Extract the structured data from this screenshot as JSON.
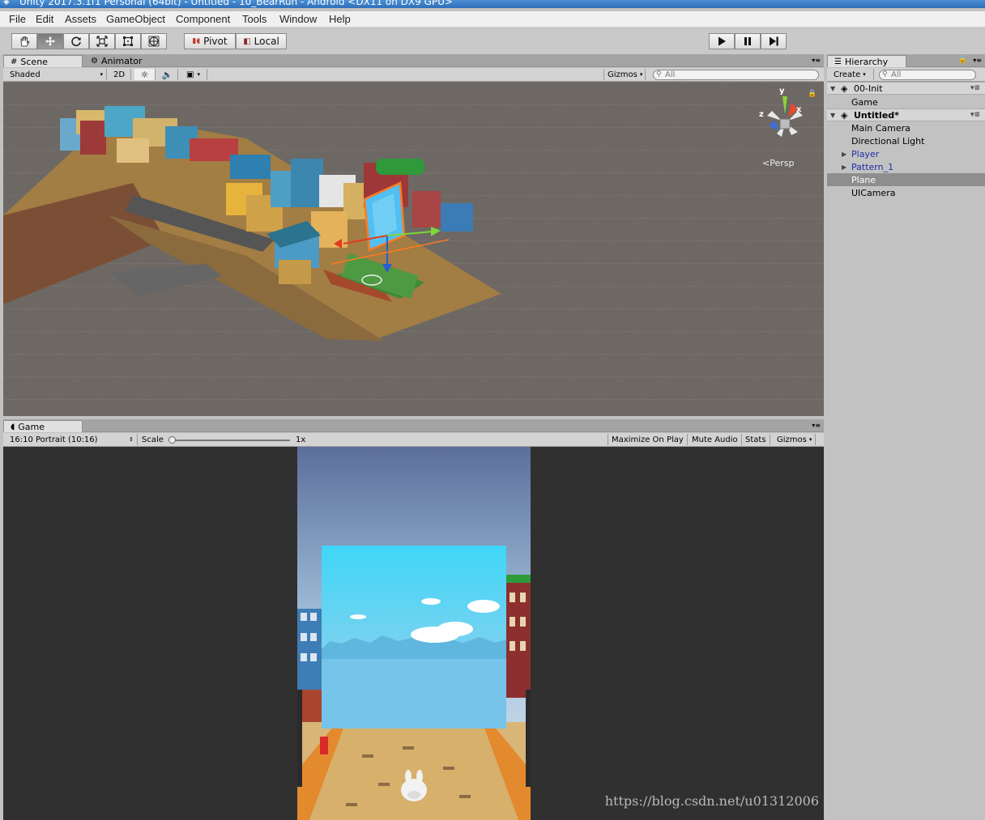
{
  "window": {
    "title": "Unity 2017.3.1f1 Personal (64bit) - Untitled - 10_BearRun - Android <DX11 on DX9 GPU>"
  },
  "menu": [
    "File",
    "Edit",
    "Assets",
    "GameObject",
    "Component",
    "Tools",
    "Window",
    "Help"
  ],
  "toolbar": {
    "tools": [
      "hand-icon",
      "move-icon",
      "rotate-icon",
      "scale-icon",
      "rect-icon",
      "transform-icon"
    ],
    "active_tool": "move-icon",
    "pivot_label": "Pivot",
    "local_label": "Local",
    "play": [
      "play-icon",
      "pause-icon",
      "step-icon"
    ]
  },
  "scene_panel": {
    "tabs": [
      {
        "label": "Scene"
      },
      {
        "label": "Animator"
      }
    ],
    "shading": "Shaded",
    "mode_2d": "2D",
    "gizmos": "Gizmos",
    "search_placeholder": "All",
    "persp": "Persp",
    "axis": {
      "y": "y",
      "x": "x",
      "z": "z"
    }
  },
  "game_panel": {
    "tab": "Game",
    "aspect": "16:10 Portrait (10:16)",
    "scale_label": "Scale",
    "scale_value": "1x",
    "buttons": [
      "Maximize On Play",
      "Mute Audio",
      "Stats",
      "Gizmos"
    ]
  },
  "hierarchy": {
    "tab": "Hierarchy",
    "create": "Create",
    "search_placeholder": "All",
    "items": [
      {
        "label": "00-Init",
        "type": "scene"
      },
      {
        "label": "Game",
        "type": "object"
      },
      {
        "label": "Untitled*",
        "type": "scene"
      },
      {
        "label": "Main Camera",
        "type": "object"
      },
      {
        "label": "Directional Light",
        "type": "object"
      },
      {
        "label": "Player",
        "type": "prefab"
      },
      {
        "label": "Pattern_1",
        "type": "prefab"
      },
      {
        "label": "Plane",
        "type": "selected"
      },
      {
        "label": "UICamera",
        "type": "object"
      }
    ]
  },
  "watermark": "https://blog.csdn.net/u01312006"
}
